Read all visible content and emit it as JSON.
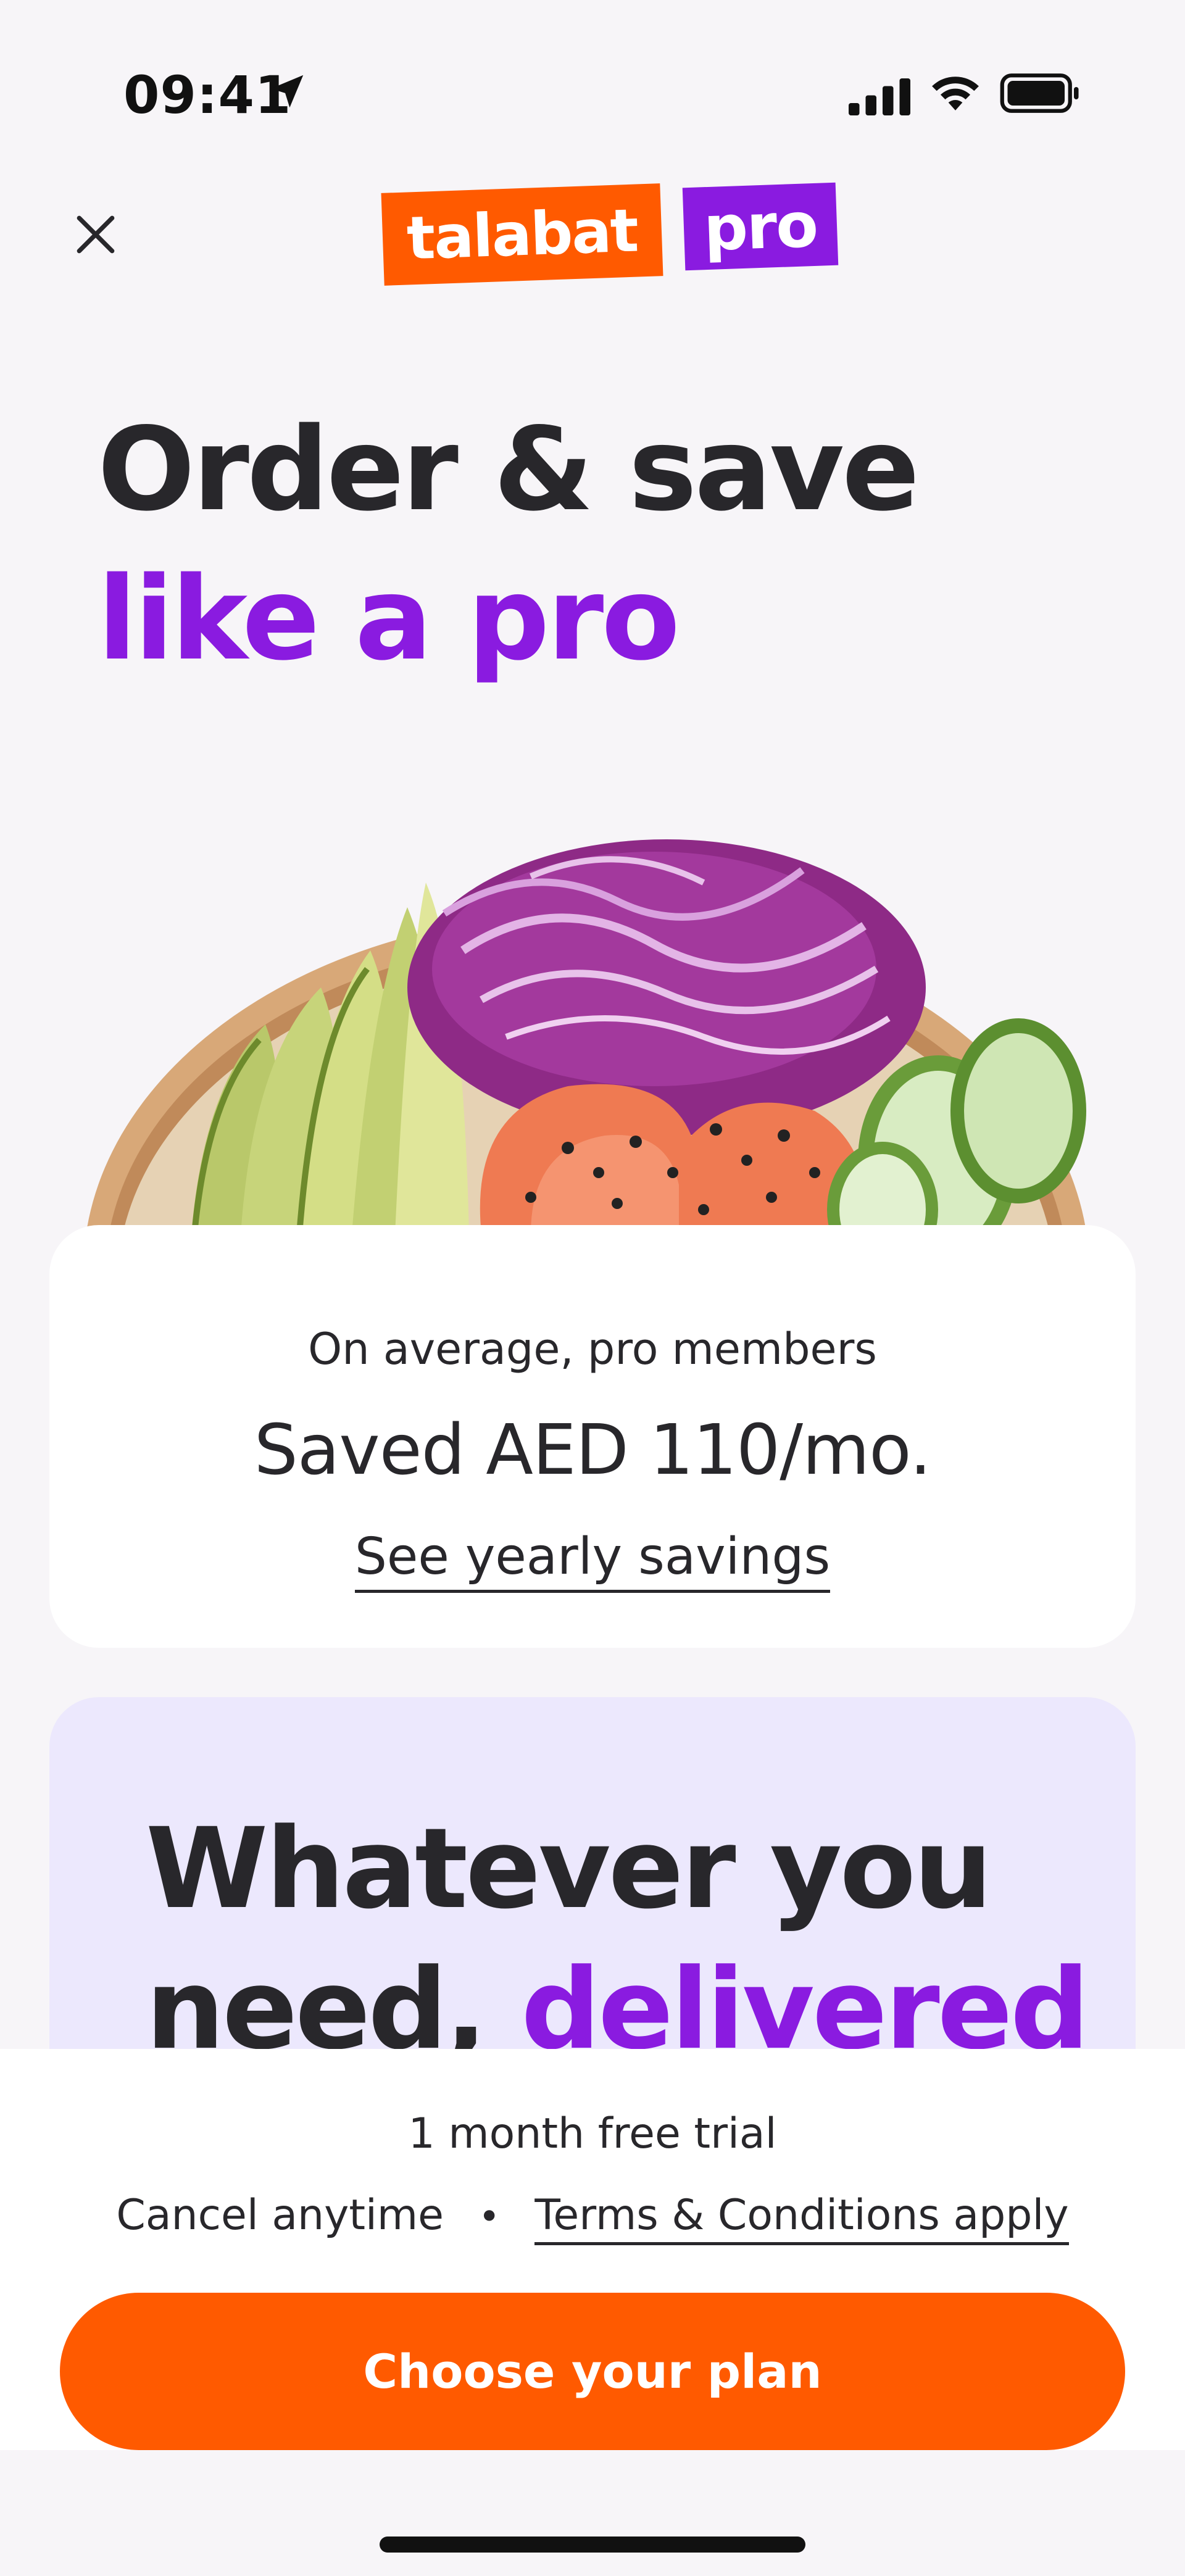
{
  "status_bar": {
    "time": "09:41"
  },
  "header": {
    "close_label": "",
    "logo": {
      "primary_text": "talabat",
      "secondary_text": "pro",
      "primary_color": "#ff5a00",
      "secondary_color": "#8a1be0"
    }
  },
  "hero": {
    "title_plain": "Order & save ",
    "title_accent": "like a pro"
  },
  "savings_card": {
    "caption": "On average, pro members",
    "amount": "Saved AED 110/mo.",
    "link_label": "See yearly savings"
  },
  "feature_card": {
    "title_plain": "Whatever you need, ",
    "title_accent": "delivered"
  },
  "cta": {
    "trial": "1 month free trial",
    "cancel": "Cancel anytime",
    "separator": "•",
    "terms": "Terms & Conditions apply",
    "button_label": "Choose your plan"
  },
  "colors": {
    "accent_purple": "#8a1be0",
    "brand_orange": "#ff5a00",
    "background": "#f7f5f8",
    "feature_card_bg": "#ece8fd"
  },
  "icons": {
    "close": "close-icon",
    "location": "location-arrow-icon",
    "signal": "cellular-signal-icon",
    "wifi": "wifi-icon",
    "battery": "battery-icon"
  }
}
